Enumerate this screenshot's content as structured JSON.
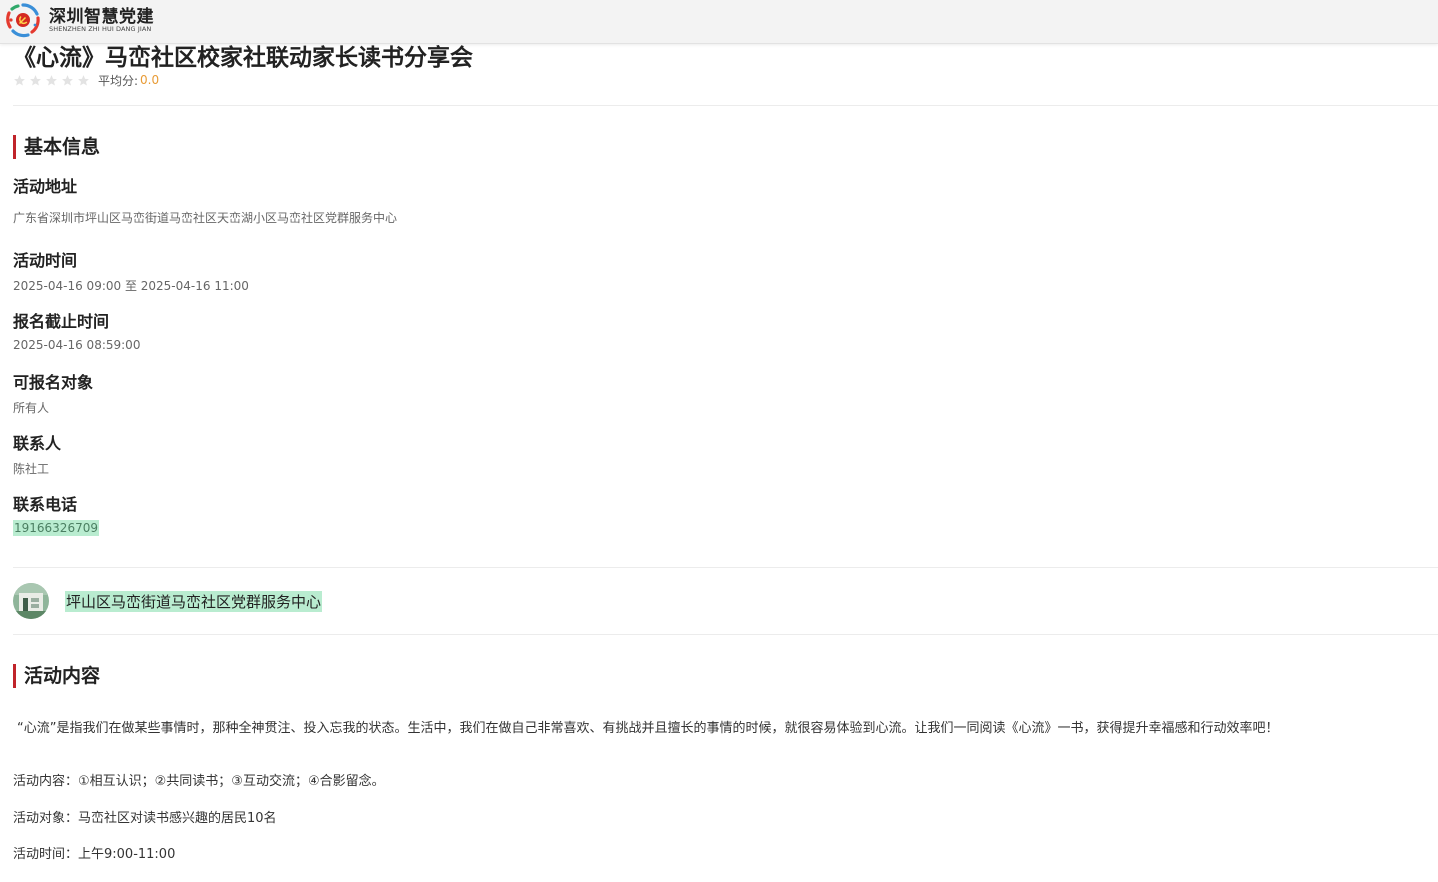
{
  "brand": {
    "name_cn": "深圳智慧党建",
    "name_en": "SHENZHEN ZHI HUI DANG JIAN"
  },
  "colors": {
    "accent": "#c0242a",
    "highlight": "#b9ecd0",
    "rating_value": "#e89b35"
  },
  "event": {
    "title": "《心流》马峦社区校家社联动家长读书分享会",
    "rating": {
      "stars_total": 5,
      "stars_filled": 0,
      "avg_label": "平均分:",
      "avg_value": "0.0"
    }
  },
  "basic_info": {
    "heading": "基本信息",
    "address_label": "活动地址",
    "address_value": "广东省深圳市坪山区马峦街道马峦社区天峦湖小区马峦社区党群服务中心",
    "time_label": "活动时间",
    "time_value": "2025-04-16 09:00 至 2025-04-16 11:00",
    "deadline_label": "报名截止时间",
    "deadline_value": "2025-04-16 08:59:00",
    "audience_label": "可报名对象",
    "audience_value": "所有人",
    "contact_label": "联系人",
    "contact_value": "陈社工",
    "phone_label": "联系电话",
    "phone_value": "19166326709"
  },
  "organizer": {
    "name": "坪山区马峦街道马峦社区党群服务中心",
    "avatar_icon": "building-photo-icon"
  },
  "content": {
    "heading": "活动内容",
    "intro": "“心流”是指我们在做某些事情时，那种全神贯注、投入忘我的状态。生活中，我们在做自己非常喜欢、有挑战并且擅长的事情的时候，就很容易体验到心流。让我们一同阅读《心流》一书，获得提升幸福感和行动效率吧！",
    "items": [
      "活动内容：①相互认识；②共同读书；③互动交流；④合影留念。",
      "活动对象：马峦社区对读书感兴趣的居民10名",
      "活动时间：上午9:00-11:00"
    ]
  }
}
